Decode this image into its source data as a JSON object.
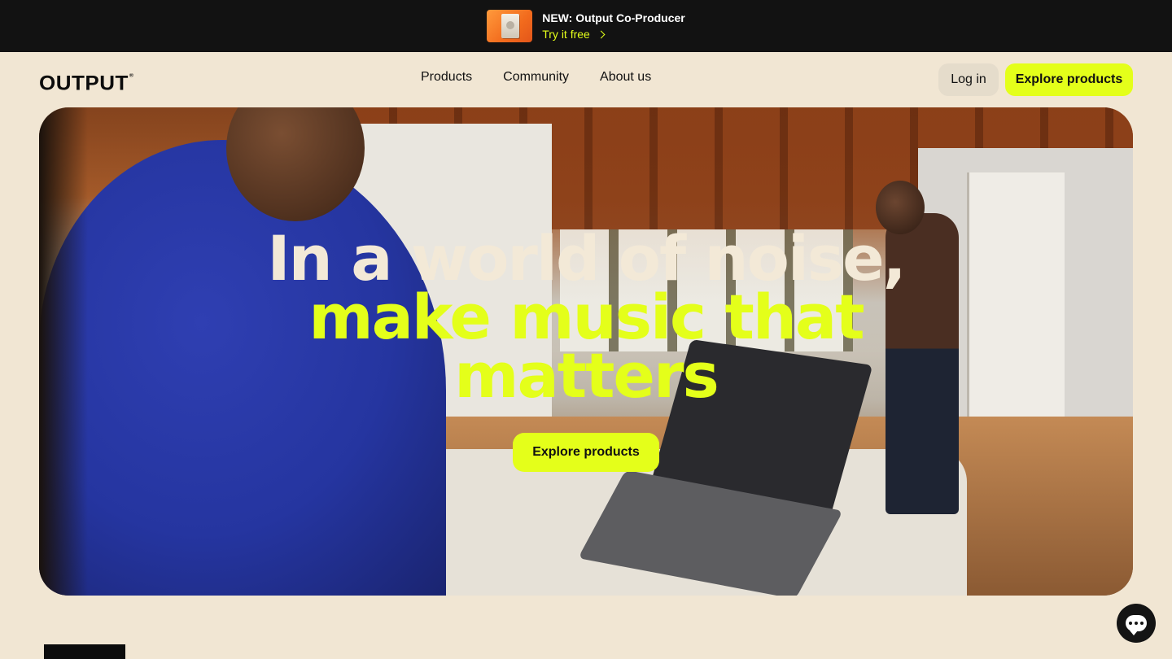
{
  "announcement": {
    "title": "NEW: Output Co-Producer",
    "link": "Try it free",
    "thumbnail_icon": "co-producer-product-icon"
  },
  "nav": {
    "logo": "OUTPUT",
    "logo_mark": "®",
    "links": [
      "Products",
      "Community",
      "About us"
    ],
    "login": "Log in",
    "cta": "Explore products"
  },
  "hero": {
    "headline_line1": "In a world of noise,",
    "headline_line2a": "make music that",
    "headline_line2b": "matters",
    "cta": "Explore products",
    "background": "photo-music-studio-room"
  },
  "chat": {
    "icon": "chat-bubble-icon"
  },
  "colors": {
    "accent": "#e4ff1a",
    "background": "#f1e6d3",
    "announcement_bg": "#121212",
    "headline_light": "#f3e9d7"
  }
}
